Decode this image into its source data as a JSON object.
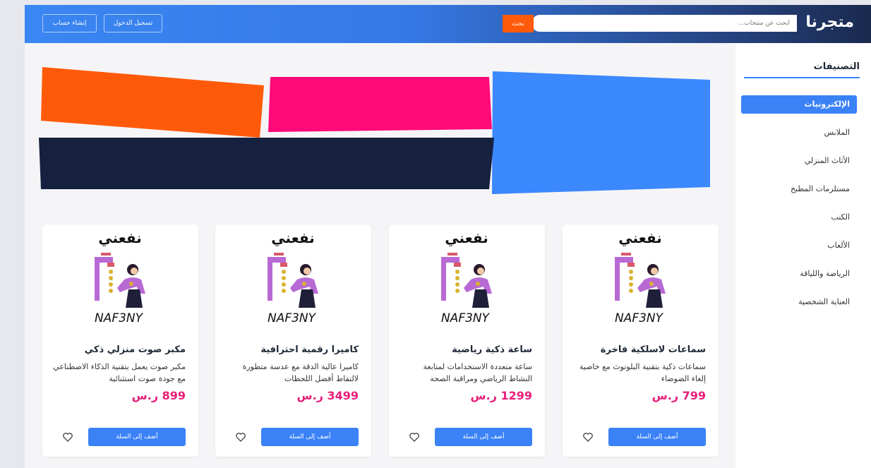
{
  "header": {
    "logo": "متجرنا",
    "search_placeholder": "ابحث عن منتجات...",
    "search_button": "بحث",
    "login_button": "تسجيل الدخول",
    "register_button": "إنشاء حساب"
  },
  "sidebar": {
    "title": "التصنيفات",
    "items": [
      {
        "label": "الإلكترونيات",
        "active": true
      },
      {
        "label": "الملابس"
      },
      {
        "label": "الأثاث المنزلي"
      },
      {
        "label": "مستلزمات المطبخ"
      },
      {
        "label": "الكتب"
      },
      {
        "label": "الألعاب"
      },
      {
        "label": "الرياضة واللياقة"
      },
      {
        "label": "العناية الشخصية"
      }
    ]
  },
  "products": [
    {
      "title": "سماعات لاسلكية فاخرة",
      "desc": "سماعات ذكية بتقنية البلوتوث مع خاصية إلغاء الضوضاء",
      "price": "799 ر.س",
      "add_label": "أضف إلى السلة"
    },
    {
      "title": "ساعة ذكية رياضية",
      "desc": "ساعة متعددة الاستخدامات لمتابعة النشاط الرياضي ومراقبة الصحة",
      "price": "1299 ر.س",
      "add_label": "أضف إلى السلة"
    },
    {
      "title": "كاميرا رقمية احترافية",
      "desc": "كاميرا عالية الدقة مع عدسة متطورة لالتقاط أفضل اللحظات",
      "price": "3499 ر.س",
      "add_label": "أضف إلى السلة"
    },
    {
      "title": "مكبر صوت منزلي ذكي",
      "desc": "مكبر صوت يعمل بتقنية الذكاء الاصطناعي مع جودة صوت استثنائية",
      "price": "899 ر.س",
      "add_label": "أضف إلى السلة"
    }
  ],
  "product_image": {
    "logo_text_ar": "نفعني",
    "logo_text_en": "NAF3NY"
  },
  "colors": {
    "accent": "#3b82f6",
    "orange": "#ff5a0a",
    "price": "#e91e78",
    "navy": "#16213f",
    "pink": "#ff0a78"
  }
}
